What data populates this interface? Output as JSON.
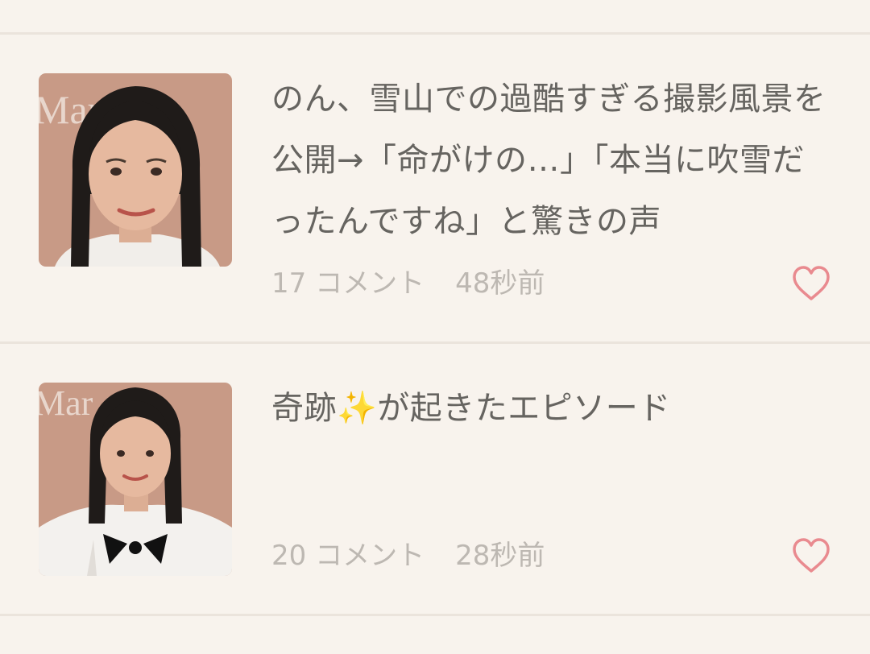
{
  "articles": [
    {
      "title": "のん、雪山での過酷すぎる撮影風景を公開→「命がけの…」「本当に吹雪だったんですね」と驚きの声",
      "comments": "17 コメント",
      "time": "48秒前",
      "thumb_backdrop_text": "Mar"
    },
    {
      "title": "奇跡✨が起きたエピソード",
      "comments": "20 コメント",
      "time": "28秒前",
      "thumb_backdrop_text": "Mar"
    }
  ],
  "icons": {
    "like": "heart-outline-icon"
  },
  "colors": {
    "background": "#f8f3ed",
    "divider": "#ebe4dc",
    "title_text": "#666460",
    "meta_text": "#bdb8b2",
    "heart": "#e98a8f"
  }
}
